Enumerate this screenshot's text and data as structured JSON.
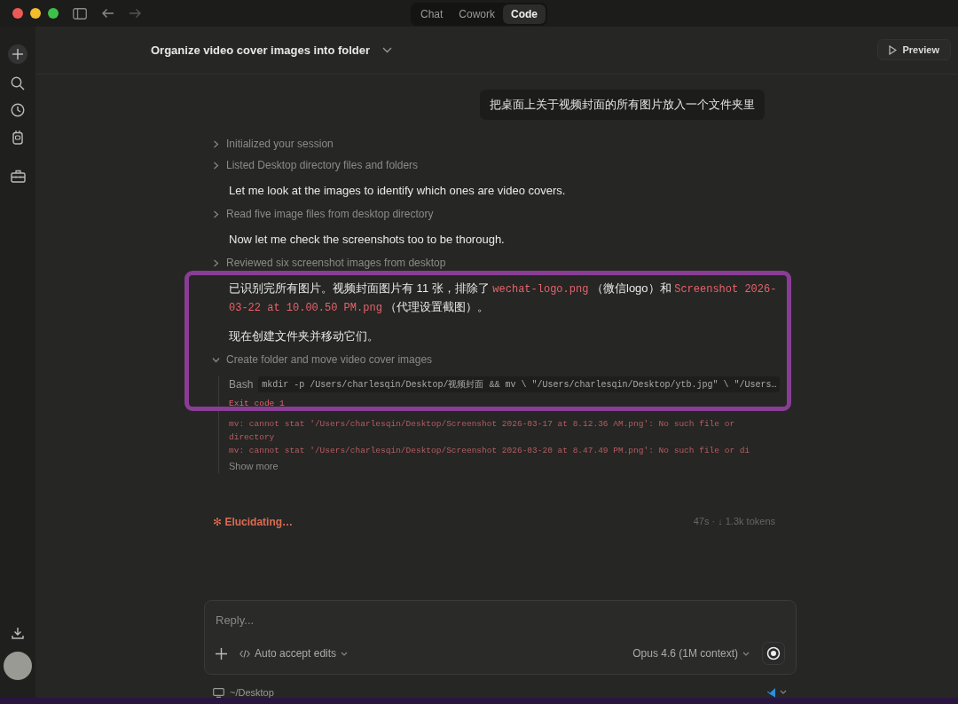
{
  "tabs": [
    {
      "label": "Chat",
      "selected": false
    },
    {
      "label": "Cowork",
      "selected": false
    },
    {
      "label": "Code",
      "selected": true
    }
  ],
  "header": {
    "title": "Organize video cover images into folder",
    "preview": "Preview"
  },
  "user_message": "把桌面上关于视频封面的所有图片放入一个文件夹里",
  "conversation": [
    {
      "kind": "step",
      "label": "Initialized your session",
      "expanded": false
    },
    {
      "kind": "step",
      "label": "Listed Desktop directory files and folders",
      "expanded": false
    },
    {
      "kind": "text",
      "text": "Let me look at the images to identify which ones are video covers."
    },
    {
      "kind": "step",
      "label": "Read five image files from desktop directory",
      "expanded": false
    },
    {
      "kind": "text",
      "text": "Now let me check the screenshots too to be thorough."
    },
    {
      "kind": "step",
      "label": "Reviewed six screenshot images from desktop",
      "expanded": false
    },
    {
      "kind": "rich",
      "segments": [
        {
          "kind": "text",
          "text": "已识别完所有图片。视频封面图片有 11 张，排除了 "
        },
        {
          "kind": "code",
          "text": "wechat-logo.png"
        },
        {
          "kind": "text",
          "text": " （微信logo）和 "
        },
        {
          "kind": "code",
          "text": "Screenshot 2026-03-22 at 10.00.50 PM.png"
        },
        {
          "kind": "text",
          "text": " （代理设置截图）。"
        }
      ]
    },
    {
      "kind": "text",
      "text": "现在创建文件夹并移动它们。"
    },
    {
      "kind": "step",
      "label": "Create folder and move video cover images",
      "expanded": true,
      "tool": "Bash",
      "command": "mkdir -p /Users/charlesqin/Desktop/视频封面 && mv \\ \"/Users/charlesqin/Desktop/ytb.jpg\" \\ \"/Users…",
      "exit": "Exit code 1",
      "output": [
        "mv: cannot stat '/Users/charlesqin/Desktop/Screenshot 2026-03-17 at 8.12.36 AM.png': No such file or directory",
        "mv: cannot stat '/Users/charlesqin/Desktop/Screenshot 2026-03-20 at 8.47.49 PM.png': No such file or di"
      ],
      "show_more": "Show more"
    }
  ],
  "status": {
    "spinner": "✻",
    "label": "Elucidating…",
    "stats": "47s · ↓ 1.3k tokens"
  },
  "composer": {
    "placeholder": "Reply...",
    "mode": "Auto accept edits",
    "model": "Opus 4.6 (1M context)"
  },
  "footer": {
    "path": "~/Desktop"
  }
}
